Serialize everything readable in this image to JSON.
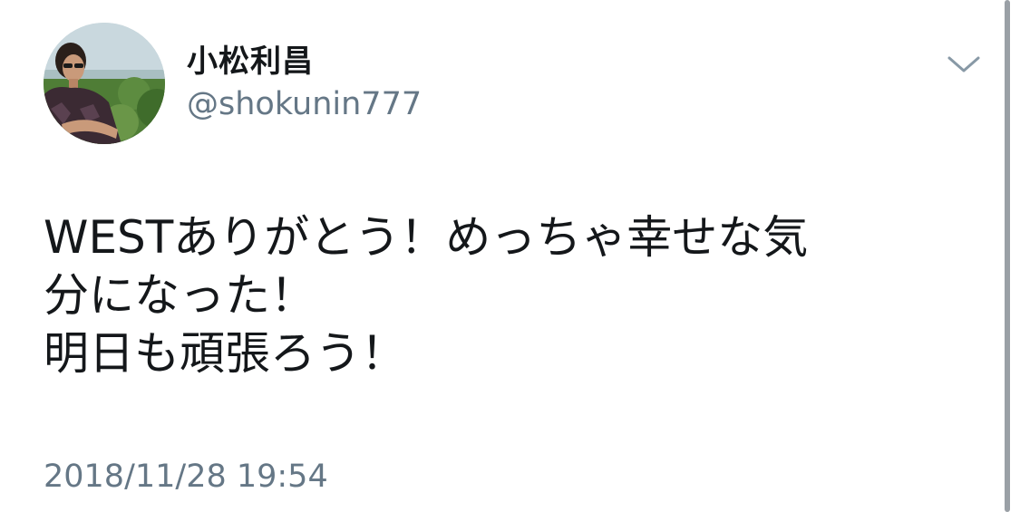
{
  "user": {
    "display_name": "小松利昌",
    "handle": "@shokunin777",
    "avatar_icon": "profile-photo"
  },
  "menu": {
    "icon": "chevron-down-icon"
  },
  "tweet": {
    "lines": [
      "WESTありがとう！めっちゃ幸せな気",
      "分になった！",
      "明日も頑張ろう！"
    ],
    "timestamp": "2018/11/28 19:54"
  },
  "colors": {
    "text": "#14171a",
    "secondary_text": "#657786",
    "background": "#ffffff",
    "scrollbar": "#9aa0a6"
  }
}
